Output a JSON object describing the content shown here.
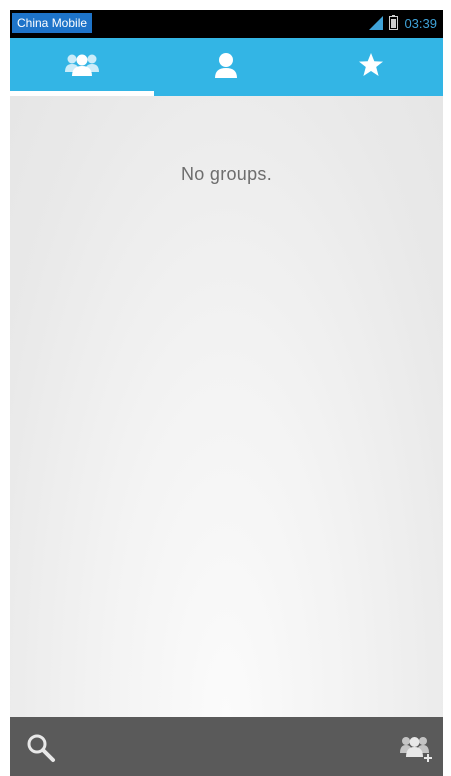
{
  "status_bar": {
    "carrier": "China Mobile",
    "time": "03:39",
    "icons": [
      "signal-icon",
      "battery-icon"
    ]
  },
  "tabs": [
    {
      "icon": "groups-icon",
      "selected": true
    },
    {
      "icon": "person-icon",
      "selected": false
    },
    {
      "icon": "star-icon",
      "selected": false
    }
  ],
  "content": {
    "empty_message": "No groups."
  },
  "bottom_bar": {
    "left_icon": "search-icon",
    "right_icon": "add-group-icon"
  },
  "colors": {
    "tab_bar": "#33b5e5",
    "status_bar": "#000000",
    "carrier_badge": "#1e74c9",
    "clock": "#3fa3d8",
    "bottom_bar": "#5a5a5a",
    "empty_text": "#6d6d6d"
  }
}
